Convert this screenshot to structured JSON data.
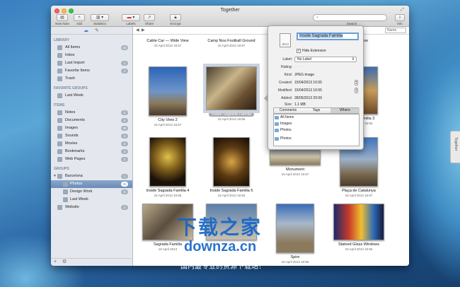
{
  "window": {
    "title": "Together"
  },
  "toolbar": {
    "new_note": "New Note",
    "add": "Add",
    "statistics": "Statistics",
    "labels": "Labels",
    "share": "Share",
    "encrypt": "Encrypt",
    "search_placeholder": "Search",
    "info": "Info"
  },
  "sidebar": {
    "library_header": "LIBRARY",
    "library": [
      {
        "label": "All Items",
        "count": "42",
        "icon": "all-items-icon"
      },
      {
        "label": "Inbox",
        "count": "",
        "icon": "inbox-icon"
      },
      {
        "label": "Last Import",
        "count": "1",
        "icon": "clock-icon"
      },
      {
        "label": "Favorite Items",
        "count": "1",
        "icon": "heart-icon"
      },
      {
        "label": "Trash",
        "count": "",
        "icon": "trash-icon"
      }
    ],
    "favorite_header": "FAVORITE GROUPS",
    "favorites": [
      {
        "label": "Last Week",
        "count": "",
        "icon": "clock-icon"
      }
    ],
    "items_header": "ITEMS",
    "items": [
      {
        "label": "Notes",
        "count": "2",
        "icon": "notes-icon"
      },
      {
        "label": "Documents",
        "count": "4",
        "icon": "documents-icon"
      },
      {
        "label": "Images",
        "count": "28",
        "icon": "images-icon"
      },
      {
        "label": "Sounds",
        "count": "2",
        "icon": "sounds-icon"
      },
      {
        "label": "Movies",
        "count": "2",
        "icon": "movies-icon"
      },
      {
        "label": "Bookmarks",
        "count": "3",
        "icon": "bookmarks-icon"
      },
      {
        "label": "Web Pages",
        "count": "2",
        "icon": "web-pages-icon"
      }
    ],
    "groups_header": "GROUPS",
    "groups": [
      {
        "label": "Barcelona",
        "count": "1",
        "icon": "folder-icon"
      },
      {
        "label": "Photos",
        "count": "26",
        "icon": "folder-icon"
      },
      {
        "label": "Design Work",
        "count": "5",
        "icon": "folder-icon"
      },
      {
        "label": "Last Week",
        "count": "",
        "icon": "clock-icon"
      },
      {
        "label": "Website",
        "count": "4",
        "icon": "folder-icon"
      }
    ],
    "bottom_add": "+"
  },
  "content": {
    "sort_label": "Name",
    "items": [
      {
        "caption": "Cable Car — Wide View",
        "date": "15 April 2013 16:57"
      },
      {
        "caption": "Camp Nou Football Ground",
        "date": "15 April 2013 16:57"
      },
      {
        "caption": "",
        "date": ""
      },
      {
        "caption": "Wide View",
        "date": ""
      },
      {
        "caption": "City View 2",
        "date": "15 April 2013 16:57"
      },
      {
        "caption": "Inside Sagrada Familia",
        "date": "15 April 2013 16:55"
      },
      {
        "caption": "",
        "date": ""
      },
      {
        "caption": "Sagrada Familia 3",
        "date": "15 April 2013 16:55"
      },
      {
        "caption": "Inside Sagrada Familia 4",
        "date": "15 April 2013 16:55"
      },
      {
        "caption": "Inside Sagrada Familia 5",
        "date": "15 April 2013 16:55"
      },
      {
        "caption": "Monument",
        "date": "15 April 2013 16:57"
      },
      {
        "caption": "Plaça de Catalunya",
        "date": "15 April 2013 16:57"
      },
      {
        "caption": "Sagrada Familia",
        "date": "15 April 2013"
      },
      {
        "caption": "",
        "date": ""
      },
      {
        "caption": "Spire",
        "date": "15 April 2013 16:55"
      },
      {
        "caption": "Stained Glass Windows",
        "date": "15 April 2013 16:55"
      }
    ]
  },
  "inspector": {
    "name": "Inside Sagrada Familia",
    "file_type_icon": "JPEG",
    "hide_extension": "Hide Extension",
    "label_label": "Label:",
    "label_value": "No Label",
    "rating_label": "Rating:",
    "kind_label": "Kind:",
    "kind_value": "JPEG image",
    "created_label": "Created:",
    "created_value": "15/04/2013 16:55",
    "modified_label": "Modified:",
    "modified_value": "15/04/2013 16:55",
    "added_label": "Added:",
    "added_value": "28/05/2013 20:09",
    "size_label": "Size:",
    "size_value": "1.1 MB",
    "tabs": [
      "Comments",
      "Tags",
      "Where"
    ],
    "where_items": [
      "All Items",
      "Images",
      "Photos",
      "Photos"
    ]
  },
  "watermark": {
    "line1": "下载之家",
    "line2": "downza.cn",
    "line3": "国内最专业的资源下载站！"
  },
  "dock_tab": "Together",
  "colors": {
    "accent": "#6b8cb8",
    "selection": "#6a9fd8"
  }
}
